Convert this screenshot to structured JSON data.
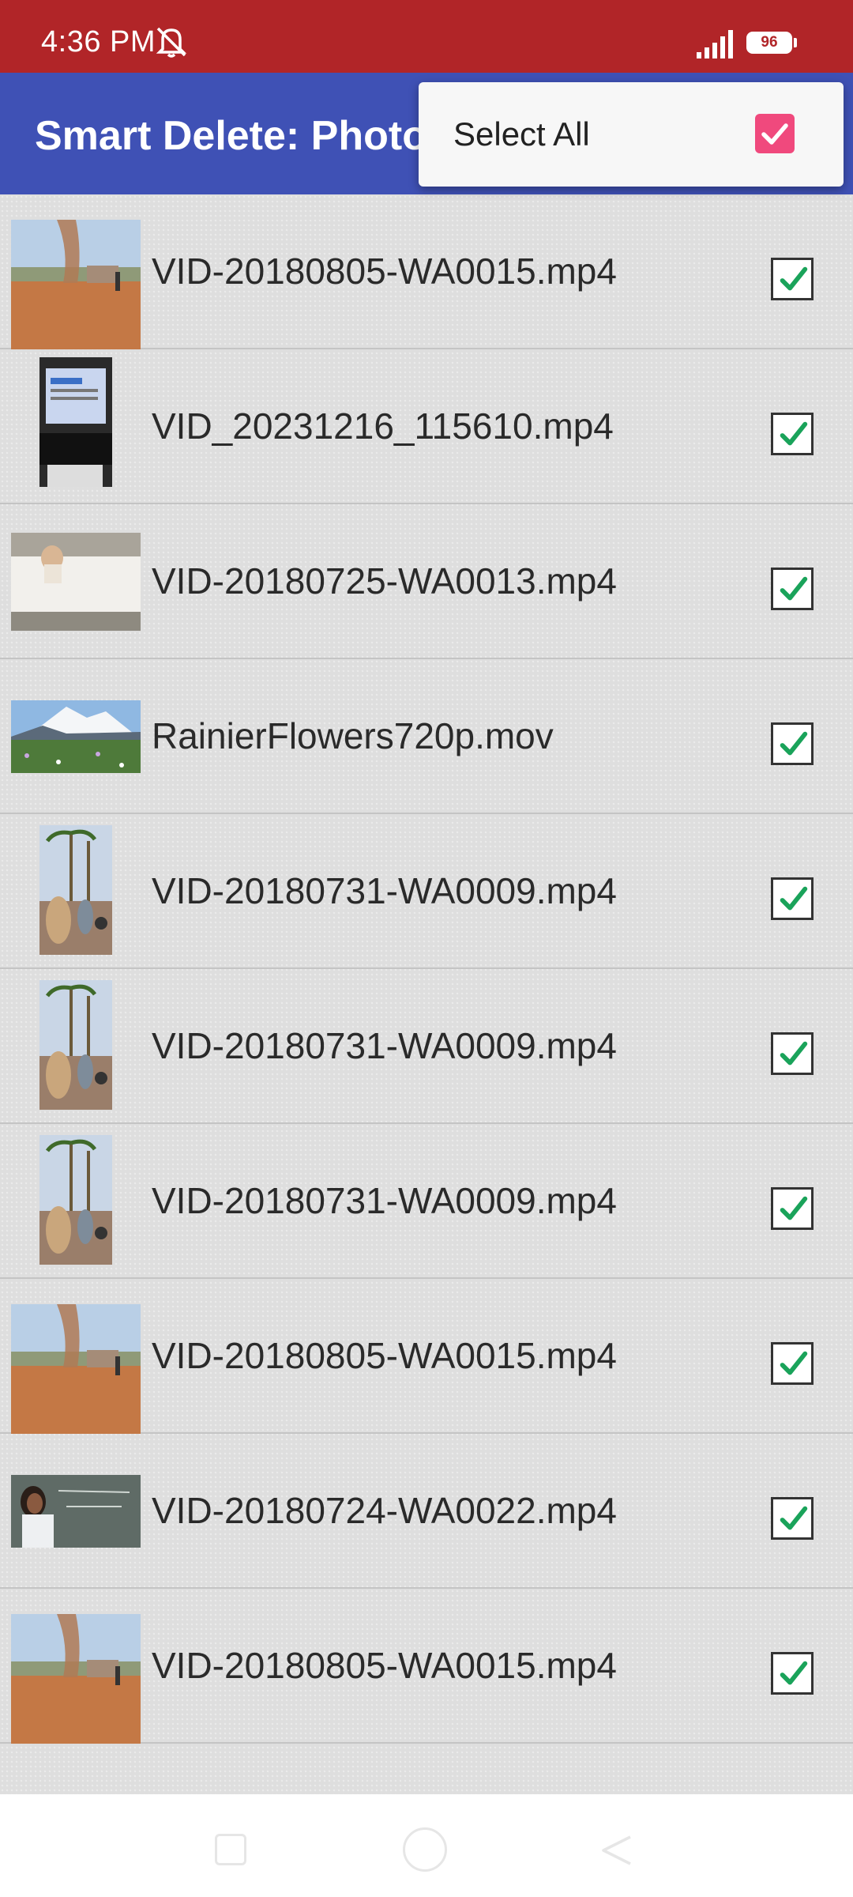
{
  "status_bar": {
    "time": "4:36 PM",
    "battery": "96"
  },
  "app_bar": {
    "title": "Smart Delete: Photo"
  },
  "menu": {
    "select_all_label": "Select All",
    "select_all_checked": true,
    "accent_color": "#f0497d"
  },
  "colors": {
    "status_bar": "#b12528",
    "app_bar": "#3f51b5",
    "check_green": "#1aa35a"
  },
  "files": [
    {
      "name": "VID-20180805-WA0015.mp4",
      "thumbnail": "dust-devil-desert",
      "checked": true
    },
    {
      "name": "VID_20231216_115610.mp4",
      "thumbnail": "laptop-screen",
      "checked": true
    },
    {
      "name": "VID-20180725-WA0013.mp4",
      "thumbnail": "child-on-bed",
      "checked": true
    },
    {
      "name": "RainierFlowers720p.mov",
      "thumbnail": "mountain-flower-meadow",
      "checked": true
    },
    {
      "name": "VID-20180731-WA0009.mp4",
      "thumbnail": "crowd-palm-trees",
      "checked": true
    },
    {
      "name": "VID-20180731-WA0009.mp4",
      "thumbnail": "crowd-palm-trees",
      "checked": true
    },
    {
      "name": "VID-20180731-WA0009.mp4",
      "thumbnail": "crowd-palm-trees",
      "checked": true
    },
    {
      "name": "VID-20180805-WA0015.mp4",
      "thumbnail": "dust-devil-desert",
      "checked": true
    },
    {
      "name": "VID-20180724-WA0022.mp4",
      "thumbnail": "teacher-chalkboard",
      "checked": true
    },
    {
      "name": "VID-20180805-WA0015.mp4",
      "thumbnail": "dust-devil-desert",
      "checked": true
    }
  ],
  "nav_bar": {
    "buttons": [
      "recents-button",
      "home-button",
      "back-button"
    ]
  }
}
